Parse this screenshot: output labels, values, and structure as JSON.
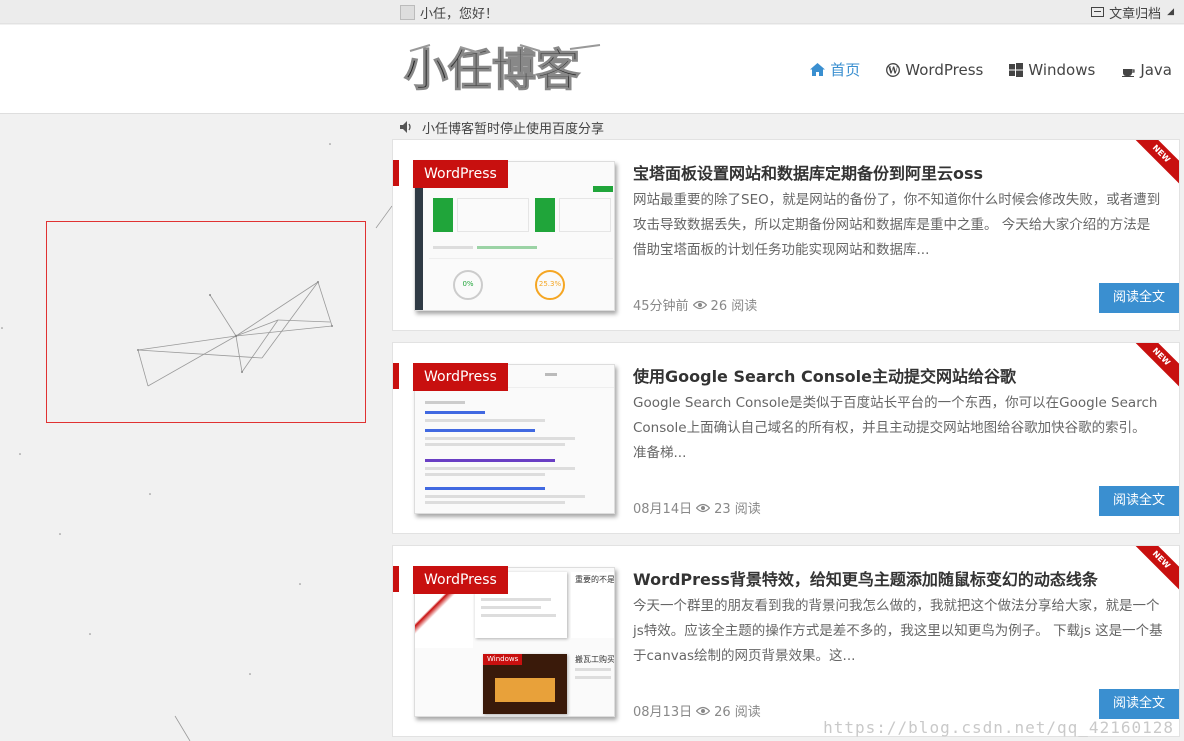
{
  "topbar": {
    "greeting": "小任，您好！",
    "archive_label": "文章归档"
  },
  "header": {
    "logo_text": "小任博客",
    "nav": [
      {
        "label": "首页",
        "icon": "home-icon",
        "active": true
      },
      {
        "label": "WordPress",
        "icon": "wordpress-icon",
        "active": false
      },
      {
        "label": "Windows",
        "icon": "windows-icon",
        "active": false
      },
      {
        "label": "Java",
        "icon": "java-icon",
        "active": false
      }
    ]
  },
  "notice": {
    "text": "小任博客暂时停止使用百度分享"
  },
  "posts": [
    {
      "category": "WordPress",
      "title": "宝塔面板设置网站和数据库定期备份到阿里云oss",
      "excerpt": "网站最重要的除了SEO，就是网站的备份了，你不知道你什么时候会修改失败，或者遭到攻击导致数据丢失，所以定期备份网站和数据库是重中之重。 今天给大家介绍的方法是借助宝塔面板的计划任务功能实现网站和数据库...",
      "time": "45分钟前",
      "views": "26 阅读",
      "read_more": "阅读全文",
      "ribbon": "NEW"
    },
    {
      "category": "WordPress",
      "title": "使用Google Search Console主动提交网站给谷歌",
      "excerpt": "Google Search Console是类似于百度站长平台的一个东西，你可以在Google Search Console上面确认自己域名的所有权，并且主动提交网站地图给谷歌加快谷歌的索引。 准备梯...",
      "time": "08月14日",
      "views": "23 阅读",
      "read_more": "阅读全文",
      "ribbon": "NEW"
    },
    {
      "category": "WordPress",
      "title": "WordPress背景特效，给知更鸟主题添加随鼠标变幻的动态线条",
      "excerpt": "今天一个群里的朋友看到我的背景问我怎么做的，我就把这个做法分享给大家，就是一个js特效。应该全主题的操作方式是差不多的，我这里以知更鸟为例子。 下载js 这是一个基于canvas绘制的网页背景效果。这...",
      "time": "08月13日",
      "views": "26 阅读",
      "read_more": "阅读全文",
      "ribbon": "NEW"
    }
  ],
  "thumb1": {
    "status_a": "0%",
    "status_b": "25.3%"
  },
  "thumb3": {
    "cat": "Windows",
    "t1": "重要的不是翻",
    "t2": "搬瓦工购买攻"
  },
  "watermark": "https://blog.csdn.net/qq_42160128",
  "colors": {
    "accent_blue": "#3a8fd0",
    "brand_red": "#c8100f"
  }
}
